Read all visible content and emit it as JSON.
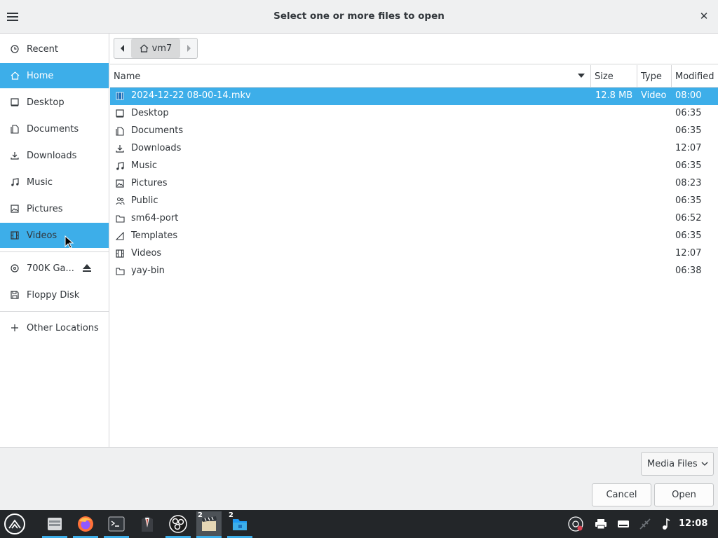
{
  "dialog": {
    "title": "Select one or more files to open"
  },
  "sidebar": {
    "items": [
      {
        "label": "Recent",
        "icon": "clock-icon"
      },
      {
        "label": "Home",
        "icon": "home-icon",
        "selected": true
      },
      {
        "label": "Desktop",
        "icon": "desktop-icon"
      },
      {
        "label": "Documents",
        "icon": "documents-icon"
      },
      {
        "label": "Downloads",
        "icon": "download-icon"
      },
      {
        "label": "Music",
        "icon": "music-note-icon"
      },
      {
        "label": "Pictures",
        "icon": "image-icon"
      },
      {
        "label": "Videos",
        "icon": "film-icon",
        "hovered": true
      }
    ],
    "devices": [
      {
        "label": "700K Ga...",
        "icon": "disc-icon",
        "eject": true
      },
      {
        "label": "Floppy Disk",
        "icon": "floppy-icon"
      }
    ],
    "other": {
      "label": "Other Locations",
      "icon": "plus-icon"
    }
  },
  "pathbar": {
    "current": "vm7"
  },
  "columns": {
    "name": "Name",
    "size": "Size",
    "type": "Type",
    "modified": "Modified"
  },
  "files": [
    {
      "name": "2024-12-22 08-00-14.mkv",
      "size": "12.8 MB",
      "type": "Video",
      "modified": "08:00",
      "icon": "video-file-icon",
      "selected": true
    },
    {
      "name": "Desktop",
      "size": "",
      "type": "",
      "modified": "06:35",
      "icon": "desktop-icon"
    },
    {
      "name": "Documents",
      "size": "",
      "type": "",
      "modified": "06:35",
      "icon": "documents-icon"
    },
    {
      "name": "Downloads",
      "size": "",
      "type": "",
      "modified": "12:07",
      "icon": "download-icon"
    },
    {
      "name": "Music",
      "size": "",
      "type": "",
      "modified": "06:35",
      "icon": "music-note-icon"
    },
    {
      "name": "Pictures",
      "size": "",
      "type": "",
      "modified": "08:23",
      "icon": "image-icon"
    },
    {
      "name": "Public",
      "size": "",
      "type": "",
      "modified": "06:35",
      "icon": "users-icon"
    },
    {
      "name": "sm64-port",
      "size": "",
      "type": "",
      "modified": "06:52",
      "icon": "folder-icon"
    },
    {
      "name": "Templates",
      "size": "",
      "type": "",
      "modified": "06:35",
      "icon": "template-icon"
    },
    {
      "name": "Videos",
      "size": "",
      "type": "",
      "modified": "12:07",
      "icon": "film-icon"
    },
    {
      "name": "yay-bin",
      "size": "",
      "type": "",
      "modified": "06:38",
      "icon": "folder-icon"
    }
  ],
  "footer": {
    "filter": "Media Files",
    "cancel": "Cancel",
    "open": "Open"
  },
  "taskbar": {
    "apps": [
      {
        "name": "file-manager-icon"
      },
      {
        "name": "firefox-icon"
      },
      {
        "name": "terminal-icon"
      },
      {
        "name": "suit-app-icon"
      },
      {
        "name": "obs-icon"
      },
      {
        "name": "clapperboard-icon",
        "badge": "2"
      },
      {
        "name": "folder-app-icon",
        "badge": "2"
      }
    ],
    "clock": "12:08"
  },
  "colors": {
    "selection": "#3daee9",
    "taskbar": "#232629",
    "chrome": "#eff0f1"
  }
}
